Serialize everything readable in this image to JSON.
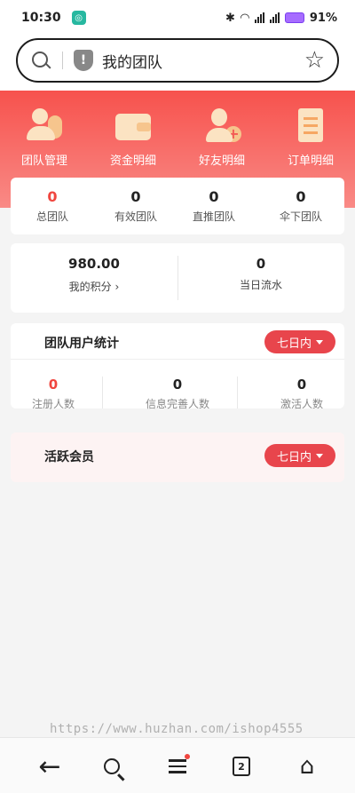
{
  "status_bar": {
    "time": "10:30",
    "battery": "91%"
  },
  "address_bar": {
    "title": "我的团队"
  },
  "nav": [
    {
      "label": "团队管理",
      "icon": "team-icon"
    },
    {
      "label": "资金明细",
      "icon": "wallet-icon"
    },
    {
      "label": "好友明细",
      "icon": "add-friend-icon"
    },
    {
      "label": "订单明细",
      "icon": "order-list-icon"
    }
  ],
  "team_counts": [
    {
      "value": "0",
      "label": "总团队"
    },
    {
      "value": "0",
      "label": "有效团队"
    },
    {
      "value": "0",
      "label": "直推团队"
    },
    {
      "value": "0",
      "label": "伞下团队"
    }
  ],
  "points": {
    "my_points_value": "980.00",
    "my_points_label": "我的积分",
    "daily_flow_value": "0",
    "daily_flow_label": "当日流水"
  },
  "team_stats": {
    "title": "团队用户统计",
    "filter": "七日内",
    "items": [
      {
        "value": "0",
        "label": "注册人数"
      },
      {
        "value": "0",
        "label": "信息完善人数"
      },
      {
        "value": "0",
        "label": "激活人数"
      }
    ]
  },
  "active_members": {
    "title": "活跃会员",
    "filter": "七日内"
  },
  "bottom_nav": {
    "tab_count": "2"
  },
  "watermark": "https://www.huzhan.com/ishop4555",
  "colors": {
    "accent": "#f0463f",
    "banner_top": "#f7524d",
    "pill": "#e8454c"
  }
}
